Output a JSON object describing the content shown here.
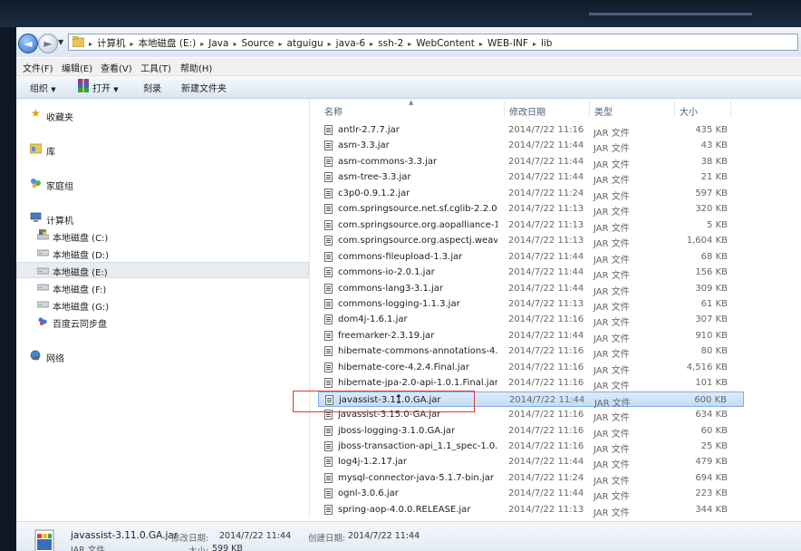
{
  "address": {
    "crumbs": [
      "计算机",
      "本地磁盘 (E:)",
      "Java",
      "Source",
      "atguigu",
      "java-6",
      "ssh-2",
      "WebContent",
      "WEB-INF",
      "lib"
    ]
  },
  "menu": [
    "文件(F)",
    "编辑(E)",
    "查看(V)",
    "工具(T)",
    "帮助(H)"
  ],
  "toolbar": {
    "organize": "组织",
    "open": "打开",
    "burn": "刻录",
    "new_folder": "新建文件夹"
  },
  "nav": {
    "favorites": "收藏夹",
    "libraries": "库",
    "homegroup": "家庭组",
    "computer": "计算机",
    "drive_c": "本地磁盘 (C:)",
    "drive_d": "本地磁盘 (D:)",
    "drive_e": "本地磁盘 (E:)",
    "drive_f": "本地磁盘 (F:)",
    "drive_g": "本地磁盘 (G:)",
    "baidu": "百度云同步盘",
    "network": "网络"
  },
  "columns": {
    "name": "名称",
    "date": "修改日期",
    "type": "类型",
    "size": "大小"
  },
  "files": [
    {
      "name": "antlr-2.7.7.jar",
      "date": "2014/7/22 11:16",
      "type": "JAR 文件",
      "size": "435 KB"
    },
    {
      "name": "asm-3.3.jar",
      "date": "2014/7/22 11:44",
      "type": "JAR 文件",
      "size": "43 KB"
    },
    {
      "name": "asm-commons-3.3.jar",
      "date": "2014/7/22 11:44",
      "type": "JAR 文件",
      "size": "38 KB"
    },
    {
      "name": "asm-tree-3.3.jar",
      "date": "2014/7/22 11:44",
      "type": "JAR 文件",
      "size": "21 KB"
    },
    {
      "name": "c3p0-0.9.1.2.jar",
      "date": "2014/7/22 11:24",
      "type": "JAR 文件",
      "size": "597 KB"
    },
    {
      "name": "com.springsource.net.sf.cglib-2.2.0.jar",
      "date": "2014/7/22 11:13",
      "type": "JAR 文件",
      "size": "320 KB"
    },
    {
      "name": "com.springsource.org.aopalliance-1....",
      "date": "2014/7/22 11:13",
      "type": "JAR 文件",
      "size": "5 KB"
    },
    {
      "name": "com.springsource.org.aspectj.weaver....",
      "date": "2014/7/22 11:13",
      "type": "JAR 文件",
      "size": "1,604 KB"
    },
    {
      "name": "commons-fileupload-1.3.jar",
      "date": "2014/7/22 11:44",
      "type": "JAR 文件",
      "size": "68 KB"
    },
    {
      "name": "commons-io-2.0.1.jar",
      "date": "2014/7/22 11:44",
      "type": "JAR 文件",
      "size": "156 KB"
    },
    {
      "name": "commons-lang3-3.1.jar",
      "date": "2014/7/22 11:44",
      "type": "JAR 文件",
      "size": "309 KB"
    },
    {
      "name": "commons-logging-1.1.3.jar",
      "date": "2014/7/22 11:13",
      "type": "JAR 文件",
      "size": "61 KB"
    },
    {
      "name": "dom4j-1.6.1.jar",
      "date": "2014/7/22 11:16",
      "type": "JAR 文件",
      "size": "307 KB"
    },
    {
      "name": "freemarker-2.3.19.jar",
      "date": "2014/7/22 11:44",
      "type": "JAR 文件",
      "size": "910 KB"
    },
    {
      "name": "hibernate-commons-annotations-4.0....",
      "date": "2014/7/22 11:16",
      "type": "JAR 文件",
      "size": "80 KB"
    },
    {
      "name": "hibernate-core-4.2.4.Final.jar",
      "date": "2014/7/22 11:16",
      "type": "JAR 文件",
      "size": "4,516 KB"
    },
    {
      "name": "hibernate-jpa-2.0-api-1.0.1.Final.jar",
      "date": "2014/7/22 11:16",
      "type": "JAR 文件",
      "size": "101 KB"
    },
    {
      "name": "javassist-3.11.0.GA.jar",
      "date": "2014/7/22 11:44",
      "type": "JAR 文件",
      "size": "600 KB"
    },
    {
      "name": "javassist-3.15.0-GA.jar",
      "date": "2014/7/22 11:16",
      "type": "JAR 文件",
      "size": "634 KB"
    },
    {
      "name": "jboss-logging-3.1.0.GA.jar",
      "date": "2014/7/22 11:16",
      "type": "JAR 文件",
      "size": "60 KB"
    },
    {
      "name": "jboss-transaction-api_1.1_spec-1.0.1....",
      "date": "2014/7/22 11:16",
      "type": "JAR 文件",
      "size": "25 KB"
    },
    {
      "name": "log4j-1.2.17.jar",
      "date": "2014/7/22 11:44",
      "type": "JAR 文件",
      "size": "479 KB"
    },
    {
      "name": "mysql-connector-java-5.1.7-bin.jar",
      "date": "2014/7/22 11:24",
      "type": "JAR 文件",
      "size": "694 KB"
    },
    {
      "name": "ognl-3.0.6.jar",
      "date": "2014/7/22 11:44",
      "type": "JAR 文件",
      "size": "223 KB"
    },
    {
      "name": "spring-aop-4.0.0.RELEASE.jar",
      "date": "2014/7/22 11:13",
      "type": "JAR 文件",
      "size": "344 KB"
    }
  ],
  "selected_index": 17,
  "details": {
    "name": "javassist-3.11.0.GA.jar",
    "type": "JAR 文件",
    "modified_label": "修改日期:",
    "modified_value": "2014/7/22 11:44",
    "created_label": "创建日期:",
    "created_value": "2014/7/22 11:44",
    "size_label": "大小:",
    "size_value": "599 KB"
  },
  "colors": {
    "highlight_box": "#e03a3a",
    "selection": "#c4ddf7"
  }
}
